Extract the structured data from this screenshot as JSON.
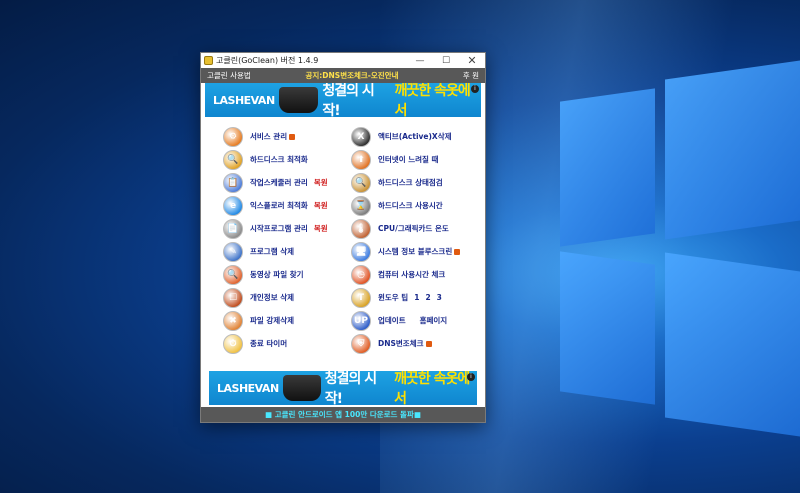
{
  "window": {
    "title": "고클린(GoClean) 버전 1.4.9",
    "minimize": "—",
    "maximize": "☐",
    "close": "✕"
  },
  "menubar": {
    "left": "고클린 사용법",
    "center": "공지:DNS변조체크-오진안내",
    "right": "후 원"
  },
  "banner": {
    "brand": "LASHEVAN",
    "main": "청결의 시작!",
    "highlight": "깨끗한 속옷에서",
    "info": "i"
  },
  "left_items": [
    {
      "label": "서비스 관리",
      "badge": true,
      "icon_color": "#e67a1e"
    },
    {
      "label": "하드디스크 최적화",
      "icon_color": "#e0a020"
    },
    {
      "label": "작업스케줄러 관리",
      "restore": "복원",
      "icon_color": "#4a7ad8"
    },
    {
      "label": "익스플로러 최적화",
      "restore": "복원",
      "icon_color": "#1e88e5"
    },
    {
      "label": "시작프로그램 관리",
      "restore": "복원",
      "icon_color": "#8a8a8a"
    },
    {
      "label": "프로그램 삭제",
      "icon_color": "#3a70c8"
    },
    {
      "label": "동영상 파일 찾기",
      "icon_color": "#e0602a"
    },
    {
      "label": "개인정보 삭제",
      "icon_color": "#c04a1a"
    },
    {
      "label": "파일 강제삭제",
      "icon_color": "#e08030"
    },
    {
      "label": "종료 타이머",
      "icon_color": "#f0c040"
    }
  ],
  "right_items": [
    {
      "label": "액티브(Active)X삭제",
      "icon_color": "#2a2a2a"
    },
    {
      "label": "인터넷이 느려질 때",
      "icon_color": "#e07020"
    },
    {
      "label": "하드디스크 상태점검",
      "icon_color": "#c89030"
    },
    {
      "label": "하드디스크 사용시간",
      "icon_color": "#7a7a7a"
    },
    {
      "label": "CPU/그래픽카드 온도",
      "icon_color": "#c06030"
    },
    {
      "label": "시스템 정보 블루스크린",
      "badge": true,
      "icon_color": "#3a7ae0"
    },
    {
      "label": "컴퓨터 사용시간 체크",
      "icon_color": "#e05020"
    },
    {
      "label": "윈도우 팁",
      "nums": [
        "1",
        "2",
        "3"
      ],
      "icon_color": "#d8a020"
    },
    {
      "label": "업데이트",
      "extra": "홈페이지",
      "icon_color": "#2a5ac8"
    },
    {
      "label": "DNS변조체크",
      "badge": true,
      "icon_color": "#e05a20"
    }
  ],
  "icon_glyphs": {
    "left": [
      "⚙",
      "🔍",
      "📋",
      "e",
      "📄",
      "✎",
      "🔍",
      "☐",
      "✖",
      "⏱"
    ],
    "right": [
      "X",
      "⬆",
      "🔍",
      "⌛",
      "🌡",
      "🖥",
      "◷",
      "T",
      "UP",
      "⛨"
    ]
  },
  "status": "■ 고클린 안드로이드 앱 100만 다운로드 돌파■"
}
